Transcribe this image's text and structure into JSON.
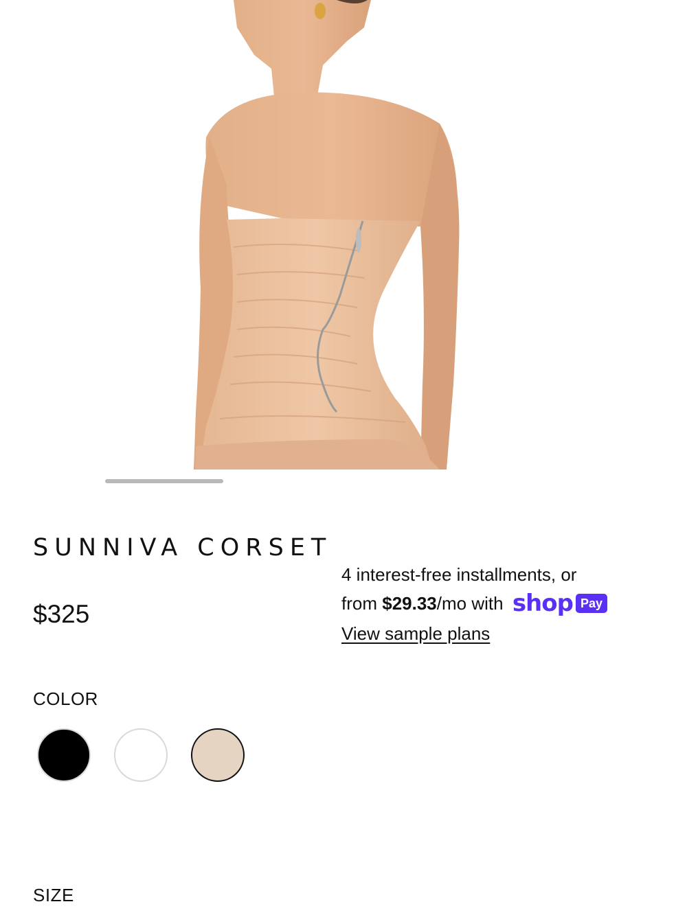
{
  "product": {
    "name": "SUNNIVA CORSET",
    "price": "$325",
    "image_alt": "Back view of model wearing nude strapless corset"
  },
  "gallery": {
    "scroll_progress": 0.33
  },
  "installments": {
    "line1": "4 interest-free installments, or",
    "from_text": "from",
    "amount": "$29.33",
    "per_text": "/mo with",
    "shop_word": "shop",
    "pay_word": "Pay",
    "link": "View sample plans",
    "brand_color": "#5a31f4"
  },
  "color": {
    "label": "COLOR",
    "swatches": [
      {
        "name": "black",
        "hex": "#000000",
        "selected": false
      },
      {
        "name": "white",
        "hex": "#ffffff",
        "selected": false
      },
      {
        "name": "nude",
        "hex": "#e6d4c3",
        "selected": true
      }
    ]
  },
  "size": {
    "label": "SIZE"
  }
}
